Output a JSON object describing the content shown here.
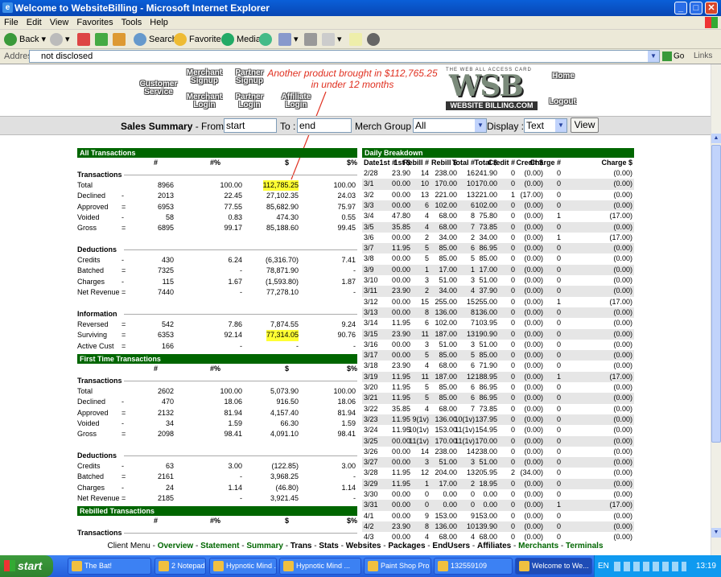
{
  "window": {
    "title": "Welcome to WebsiteBilling - Microsoft Internet Explorer"
  },
  "menu": [
    "File",
    "Edit",
    "View",
    "Favorites",
    "Tools",
    "Help"
  ],
  "toolbar": {
    "back": "Back",
    "search": "Search",
    "favorites": "Favorites",
    "media": "Media"
  },
  "address": {
    "label": "Address",
    "value": "not disclosed",
    "go": "Go",
    "links": "Links"
  },
  "nav": {
    "customer_service": "Customer Service",
    "merchant_signup": "Merchant Signup",
    "merchant_login": "Merchant Login",
    "partner_signup": "Partner Signup",
    "partner_login": "Partner Login",
    "affiliate_login": "Affiliate Login",
    "home": "Home",
    "logout": "Logout"
  },
  "logo": {
    "text": "WSB",
    "sub": "WEBSITE BILLING.COM",
    "top": "THE WEB ALL ACCESS CARD"
  },
  "annotation": {
    "line1": "Another product brought in $112,765.25",
    "line2": "in under 12 months"
  },
  "summary": {
    "title": "Sales Summary",
    "from_label": " - From :",
    "from_value": "start",
    "to_label": "To :",
    "to_value": "end",
    "merch_label": "Merch Group :",
    "merch_value": "All",
    "display_label": "Display :",
    "display_value": "Text",
    "view_button": "View"
  },
  "left": {
    "col_headers": [
      "#",
      "#%",
      "$",
      "$%"
    ],
    "all_title": "All Transactions",
    "first_title": "First Time Transactions",
    "rebilled_title": "Rebilled Transactions",
    "all": {
      "transactions": {
        "label": "Transactions",
        "rows": [
          [
            "Total",
            "",
            "8966",
            "100.00",
            "112,785.25",
            "100.00"
          ],
          [
            "Declined",
            "-",
            "2013",
            "22.45",
            "27,102.35",
            "24.03"
          ],
          [
            "Approved",
            "=",
            "6953",
            "77.55",
            "85,682.90",
            "75.97"
          ],
          [
            "Voided",
            "-",
            "58",
            "0.83",
            "474.30",
            "0.55"
          ],
          [
            "Gross",
            "=",
            "6895",
            "99.17",
            "85,188.60",
            "99.45"
          ]
        ]
      },
      "deductions": {
        "label": "Deductions",
        "rows": [
          [
            "Credits",
            "-",
            "430",
            "6.24",
            "(6,316.70)",
            "7.41"
          ],
          [
            "Batched",
            "=",
            "7325",
            "-",
            "78,871.90",
            "-"
          ],
          [
            "Charges",
            "-",
            "115",
            "1.67",
            "(1,593.80)",
            "1.87"
          ],
          [
            "Net Revenue",
            "=",
            "7440",
            "-",
            "77,278.10",
            "-"
          ]
        ]
      },
      "information": {
        "label": "Information",
        "rows": [
          [
            "Reversed",
            "=",
            "542",
            "7.86",
            "7,874.55",
            "9.24"
          ],
          [
            "Surviving",
            "=",
            "6353",
            "92.14",
            "77,314.05",
            "90.76"
          ],
          [
            "Active Cust",
            "=",
            "166",
            "-",
            "-",
            "-"
          ]
        ]
      }
    },
    "first": {
      "transactions": {
        "label": "Transactions",
        "rows": [
          [
            "Total",
            "",
            "2602",
            "100.00",
            "5,073.90",
            "100.00"
          ],
          [
            "Declined",
            "-",
            "470",
            "18.06",
            "916.50",
            "18.06"
          ],
          [
            "Approved",
            "=",
            "2132",
            "81.94",
            "4,157.40",
            "81.94"
          ],
          [
            "Voided",
            "-",
            "34",
            "1.59",
            "66.30",
            "1.59"
          ],
          [
            "Gross",
            "=",
            "2098",
            "98.41",
            "4,091.10",
            "98.41"
          ]
        ]
      },
      "deductions": {
        "label": "Deductions",
        "rows": [
          [
            "Credits",
            "-",
            "63",
            "3.00",
            "(122.85)",
            "3.00"
          ],
          [
            "Batched",
            "=",
            "2161",
            "-",
            "3,968.25",
            "-"
          ],
          [
            "Charges",
            "-",
            "24",
            "1.14",
            "(46.80)",
            "1.14"
          ],
          [
            "Net Revenue",
            "=",
            "2185",
            "-",
            "3,921.45",
            "-"
          ]
        ]
      }
    },
    "rebilled": {
      "transactions_label": "Transactions"
    }
  },
  "daily": {
    "title": "Daily Breakdown",
    "headers": [
      "Date",
      "1st #",
      "1st $",
      "Rebill #",
      "Rebill $",
      "Total #",
      "Total $",
      "Credit #",
      "Credit $",
      "Charge #",
      "Charge $"
    ],
    "rows": [
      [
        "2/28",
        "2",
        "3.90",
        "14",
        "238.00",
        "16",
        "241.90",
        "0",
        "(0.00)",
        "0",
        "(0.00)"
      ],
      [
        "3/1",
        "0",
        "0.00",
        "10",
        "170.00",
        "10",
        "170.00",
        "0",
        "(0.00)",
        "0",
        "(0.00)"
      ],
      [
        "3/2",
        "0",
        "0.00",
        "13",
        "221.00",
        "13",
        "221.00",
        "1",
        "(17.00)",
        "0",
        "(0.00)"
      ],
      [
        "3/3",
        "0",
        "0.00",
        "6",
        "102.00",
        "6",
        "102.00",
        "0",
        "(0.00)",
        "0",
        "(0.00)"
      ],
      [
        "3/4",
        "4",
        "7.80",
        "4",
        "68.00",
        "8",
        "75.80",
        "0",
        "(0.00)",
        "1",
        "(17.00)"
      ],
      [
        "3/5",
        "3",
        "5.85",
        "4",
        "68.00",
        "7",
        "73.85",
        "0",
        "(0.00)",
        "0",
        "(0.00)"
      ],
      [
        "3/6",
        "0",
        "0.00",
        "2",
        "34.00",
        "2",
        "34.00",
        "0",
        "(0.00)",
        "1",
        "(17.00)"
      ],
      [
        "3/7",
        "1",
        "1.95",
        "5",
        "85.00",
        "6",
        "86.95",
        "0",
        "(0.00)",
        "0",
        "(0.00)"
      ],
      [
        "3/8",
        "0",
        "0.00",
        "5",
        "85.00",
        "5",
        "85.00",
        "0",
        "(0.00)",
        "0",
        "(0.00)"
      ],
      [
        "3/9",
        "0",
        "0.00",
        "1",
        "17.00",
        "1",
        "17.00",
        "0",
        "(0.00)",
        "0",
        "(0.00)"
      ],
      [
        "3/10",
        "0",
        "0.00",
        "3",
        "51.00",
        "3",
        "51.00",
        "0",
        "(0.00)",
        "0",
        "(0.00)"
      ],
      [
        "3/11",
        "2",
        "3.90",
        "2",
        "34.00",
        "4",
        "37.90",
        "0",
        "(0.00)",
        "0",
        "(0.00)"
      ],
      [
        "3/12",
        "0",
        "0.00",
        "15",
        "255.00",
        "15",
        "255.00",
        "0",
        "(0.00)",
        "1",
        "(17.00)"
      ],
      [
        "3/13",
        "0",
        "0.00",
        "8",
        "136.00",
        "8",
        "136.00",
        "0",
        "(0.00)",
        "0",
        "(0.00)"
      ],
      [
        "3/14",
        "1",
        "1.95",
        "6",
        "102.00",
        "7",
        "103.95",
        "0",
        "(0.00)",
        "0",
        "(0.00)"
      ],
      [
        "3/15",
        "2",
        "3.90",
        "11",
        "187.00",
        "13",
        "190.90",
        "0",
        "(0.00)",
        "0",
        "(0.00)"
      ],
      [
        "3/16",
        "0",
        "0.00",
        "3",
        "51.00",
        "3",
        "51.00",
        "0",
        "(0.00)",
        "0",
        "(0.00)"
      ],
      [
        "3/17",
        "0",
        "0.00",
        "5",
        "85.00",
        "5",
        "85.00",
        "0",
        "(0.00)",
        "0",
        "(0.00)"
      ],
      [
        "3/18",
        "2",
        "3.90",
        "4",
        "68.00",
        "6",
        "71.90",
        "0",
        "(0.00)",
        "0",
        "(0.00)"
      ],
      [
        "3/19",
        "1",
        "1.95",
        "11",
        "187.00",
        "12",
        "188.95",
        "0",
        "(0.00)",
        "1",
        "(17.00)"
      ],
      [
        "3/20",
        "1",
        "1.95",
        "5",
        "85.00",
        "6",
        "86.95",
        "0",
        "(0.00)",
        "0",
        "(0.00)"
      ],
      [
        "3/21",
        "1",
        "1.95",
        "5",
        "85.00",
        "6",
        "86.95",
        "0",
        "(0.00)",
        "0",
        "(0.00)"
      ],
      [
        "3/22",
        "3",
        "5.85",
        "4",
        "68.00",
        "7",
        "73.85",
        "0",
        "(0.00)",
        "0",
        "(0.00)"
      ],
      [
        "3/23",
        "1",
        "1.95",
        "9(1v)",
        "136.00",
        "10(1v)",
        "137.95",
        "0",
        "(0.00)",
        "0",
        "(0.00)"
      ],
      [
        "3/24",
        "1",
        "1.95",
        "10(1v)",
        "153.00",
        "11(1v)",
        "154.95",
        "0",
        "(0.00)",
        "0",
        "(0.00)"
      ],
      [
        "3/25",
        "0",
        "0.00",
        "11(1v)",
        "170.00",
        "11(1v)",
        "170.00",
        "0",
        "(0.00)",
        "0",
        "(0.00)"
      ],
      [
        "3/26",
        "0",
        "0.00",
        "14",
        "238.00",
        "14",
        "238.00",
        "0",
        "(0.00)",
        "0",
        "(0.00)"
      ],
      [
        "3/27",
        "0",
        "0.00",
        "3",
        "51.00",
        "3",
        "51.00",
        "0",
        "(0.00)",
        "0",
        "(0.00)"
      ],
      [
        "3/28",
        "1",
        "1.95",
        "12",
        "204.00",
        "13",
        "205.95",
        "2",
        "(34.00)",
        "0",
        "(0.00)"
      ],
      [
        "3/29",
        "1",
        "1.95",
        "1",
        "17.00",
        "2",
        "18.95",
        "0",
        "(0.00)",
        "0",
        "(0.00)"
      ],
      [
        "3/30",
        "0",
        "0.00",
        "0",
        "0.00",
        "0",
        "0.00",
        "0",
        "(0.00)",
        "0",
        "(0.00)"
      ],
      [
        "3/31",
        "0",
        "0.00",
        "0",
        "0.00",
        "0",
        "0.00",
        "0",
        "(0.00)",
        "1",
        "(17.00)"
      ],
      [
        "4/1",
        "0",
        "0.00",
        "9",
        "153.00",
        "9",
        "153.00",
        "0",
        "(0.00)",
        "0",
        "(0.00)"
      ],
      [
        "4/2",
        "2",
        "3.90",
        "8",
        "136.00",
        "10",
        "139.90",
        "0",
        "(0.00)",
        "0",
        "(0.00)"
      ],
      [
        "4/3",
        "0",
        "0.00",
        "4",
        "68.00",
        "4",
        "68.00",
        "0",
        "(0.00)",
        "0",
        "(0.00)"
      ]
    ]
  },
  "footer": {
    "prefix": "Client Menu - ",
    "links": [
      "Overview",
      "Statement",
      "Summary",
      "Trans",
      "Stats",
      "Websites",
      "Packages",
      "EndUsers",
      "Affiliates",
      "Merchants",
      "Terminals"
    ]
  },
  "taskbar": {
    "start": "start",
    "tasks": [
      "The Bat!",
      "2 Notepad",
      "Hypnotic Mind ...",
      "Hypnotic Mind ...",
      "Paint Shop Pro ...",
      "132559109",
      "Welcome to We..."
    ],
    "lang": "EN",
    "clock": "13:19"
  },
  "colors": {
    "header_green": "#006600",
    "link_green": "#006600",
    "highlight": "#ffff33",
    "annotation_red": "#e03020"
  }
}
